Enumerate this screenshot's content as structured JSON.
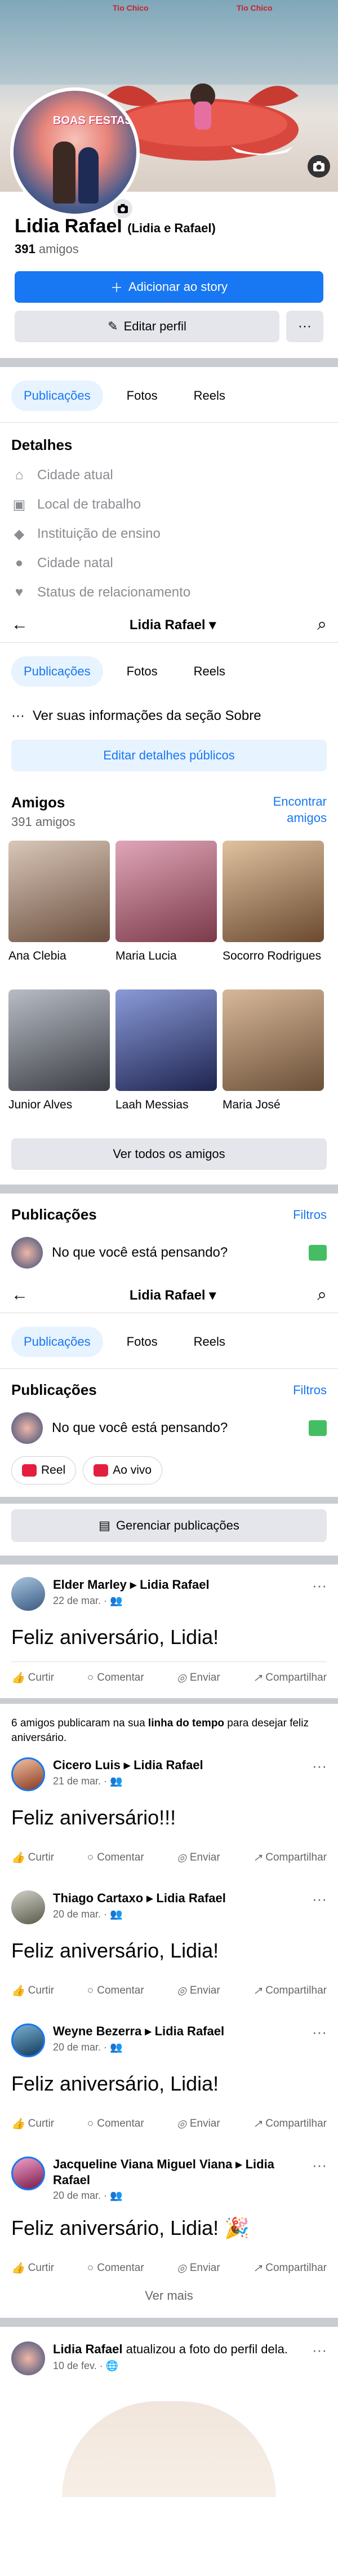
{
  "cover": {
    "sign_left": "Tio Chico",
    "sign_right": "Tio Chico",
    "avatar_text": "BOAS FESTAS"
  },
  "profile": {
    "name": "Lidia Rafael",
    "alt_name": "(Lidia e Rafael)",
    "friends_count": "391",
    "friends_word": "amigos"
  },
  "buttons": {
    "add_story": "Adicionar ao story",
    "edit_profile": "Editar perfil",
    "more": "···"
  },
  "tabs": [
    "Publicações",
    "Fotos",
    "Reels"
  ],
  "details": {
    "title": "Detalhes",
    "items": [
      {
        "icon": "house-icon",
        "label": "Cidade atual"
      },
      {
        "icon": "briefcase-icon",
        "label": "Local de trabalho"
      },
      {
        "icon": "graduation-cap-icon",
        "label": "Instituição de ensino"
      },
      {
        "icon": "location-icon",
        "label": "Cidade natal"
      },
      {
        "icon": "heart-icon",
        "label": "Status de relacionamento"
      }
    ]
  },
  "sticky": {
    "title": "Lidia Rafael ▾"
  },
  "about": {
    "link": "Ver suas informações da seção Sobre",
    "edit_button": "Editar detalhes públicos"
  },
  "friends": {
    "title": "Amigos",
    "count": "391 amigos",
    "find_link": "Encontrar amigos",
    "list": [
      {
        "name": "Ana Clebia",
        "color": "#8a7060"
      },
      {
        "name": "Maria Lucia",
        "color": "#c46c7a"
      },
      {
        "name": "Socorro Rodrigues",
        "color": "#a67a5a"
      },
      {
        "name": "Junior Alves",
        "color": "#6b6f78"
      },
      {
        "name": "Laah Messias",
        "color": "#3d4a8a"
      },
      {
        "name": "Maria José",
        "color": "#b08a6a"
      }
    ],
    "see_all": "Ver todos os amigos"
  },
  "publications": {
    "title": "Publicações",
    "filters": "Filtros",
    "composer": "No que você está pensando?",
    "reel": "Reel",
    "live": "Ao vivo",
    "manage": "Gerenciar publicações"
  },
  "actions": {
    "like": "Curtir",
    "comment": "Comentar",
    "send": "Enviar",
    "share": "Compartilhar"
  },
  "posts": [
    {
      "who": "Elder Marley ▸ Lidia Rafael",
      "when": "22 de mar. · 👥",
      "text": "Feliz aniversário, Lidia!",
      "color": "#5b7fb5"
    },
    {
      "who": "Cicero Luis ▸ Lidia Rafael",
      "when": "21 de mar. · 👥",
      "text": "Feliz aniversário!!!",
      "color": "#b85a3c"
    },
    {
      "who": "Thiago Cartaxo ▸ Lidia Rafael",
      "when": "20 de mar. · 👥",
      "text": "Feliz aniversário, Lidia!",
      "color": "#8a8a7a"
    },
    {
      "who": "Weyne Bezerra ▸ Lidia Rafael",
      "when": "20 de mar. · 👥",
      "text": "Feliz aniversário, Lidia!",
      "color": "#2b6a8a"
    },
    {
      "who": "Jacqueline Viana Miguel Viana ▸ Lidia Rafael",
      "when": "20 de mar. · 👥",
      "text": "Feliz aniversário, Lidia! 🎉",
      "color": "#c2408a"
    }
  ],
  "birthday_note": {
    "pre": "6 amigos publicaram na sua ",
    "bold": "linha do tempo",
    "post": " para desejar feliz aniversário."
  },
  "see_more": "Ver mais",
  "update": {
    "name": "Lidia Rafael",
    "text": " atualizou a foto do perfil dela.",
    "when": "10 de fev. · 🌐"
  }
}
